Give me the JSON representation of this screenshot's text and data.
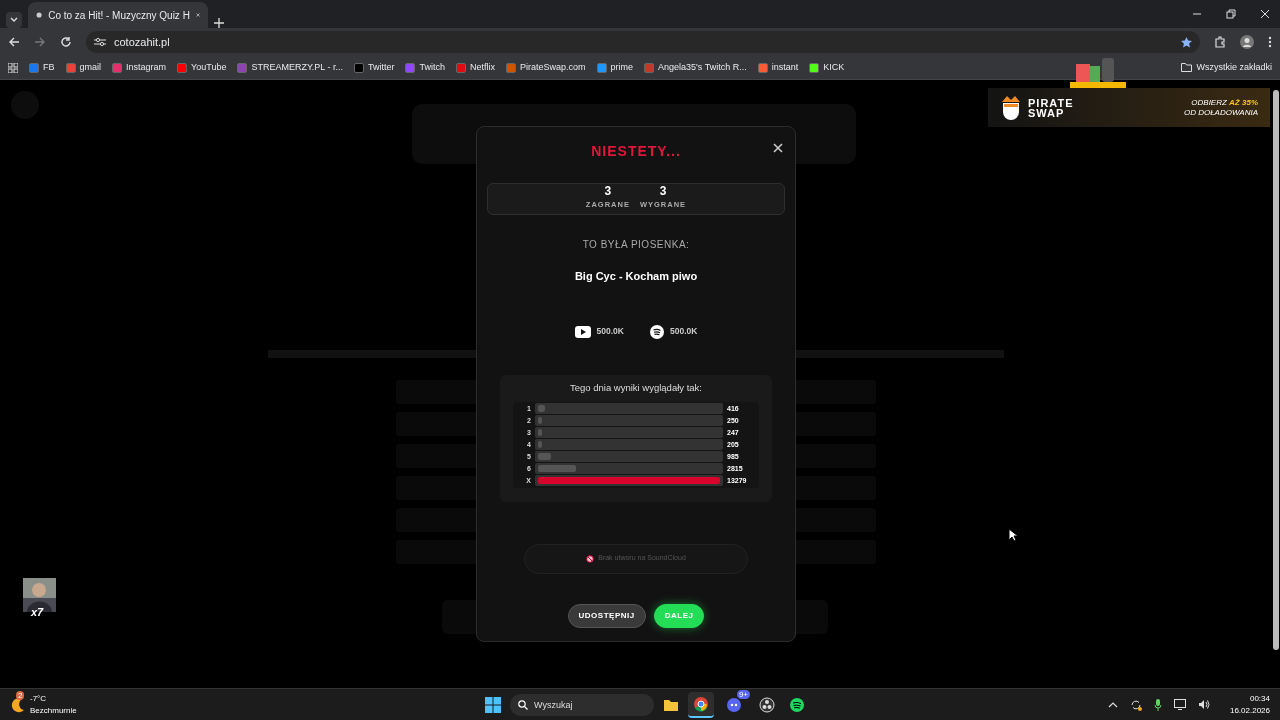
{
  "browser": {
    "tabs": [
      {
        "title": "Co to za Hit! - Muzyczny Quiz H",
        "selected": true
      }
    ],
    "address": "cotozahit.pl",
    "bookmarks": [
      {
        "label": "FB",
        "color": "#1877f2"
      },
      {
        "label": "gmail",
        "color": "#ea4335"
      },
      {
        "label": "Instagram",
        "color": "#e1306c"
      },
      {
        "label": "YouTube",
        "color": "#ff0000"
      },
      {
        "label": "STREAMERZY.PL - r...",
        "color": "#8e44ad"
      },
      {
        "label": "Twitter",
        "color": "#000000"
      },
      {
        "label": "Twitch",
        "color": "#9146ff"
      },
      {
        "label": "Netflix",
        "color": "#e50914"
      },
      {
        "label": "PirateSwap.com",
        "color": "#d35400"
      },
      {
        "label": "prime",
        "color": "#1a98ff"
      },
      {
        "label": "Angela35's Twitch R...",
        "color": "#c0392b"
      },
      {
        "label": "instant",
        "color": "#ff5a36"
      },
      {
        "label": "KICK",
        "color": "#53fc18"
      }
    ],
    "all_bookmarks": "Wszystkie zakładki"
  },
  "ad": {
    "brand_top": "PIRATE",
    "brand_bottom": "SWAP",
    "offer": "ODBIERZ **AŻ 35%**",
    "offer_line2": "OD DOŁADOWANIA"
  },
  "overlay": {
    "counter": "x7"
  },
  "modal": {
    "title": "NIESTETY...",
    "stats": [
      {
        "value": "3",
        "label": "ZAGRANE"
      },
      {
        "value": "3",
        "label": "WYGRANE"
      }
    ],
    "song_label": "TO BYŁA PIOSENKA:",
    "song": "Big Cyc - Kocham piwo",
    "counts": [
      {
        "kind": "youtube",
        "value": "500.0K"
      },
      {
        "kind": "spotify",
        "value": "500.0K"
      }
    ],
    "results": {
      "title": "Tego dnia wyniki wyglądały tak:",
      "rows": [
        {
          "label": "1",
          "value": "416",
          "level": 0.04,
          "highlight": false
        },
        {
          "label": "2",
          "value": "250",
          "level": 0.02,
          "highlight": false
        },
        {
          "label": "3",
          "value": "247",
          "level": 0.02,
          "highlight": false
        },
        {
          "label": "4",
          "value": "205",
          "level": 0.02,
          "highlight": false
        },
        {
          "label": "5",
          "value": "985",
          "level": 0.074,
          "highlight": false
        },
        {
          "label": "6",
          "value": "2815",
          "level": 0.21,
          "highlight": false
        },
        {
          "label": "X",
          "value": "13279",
          "level": 1,
          "highlight": true
        }
      ]
    },
    "soundcloud": "Brak utworu na SoundCloud",
    "buttons": [
      {
        "label": "UDOSTĘPNIJ",
        "kind": "secondary"
      },
      {
        "label": "DALEJ",
        "kind": "primary"
      }
    ]
  },
  "taskbar": {
    "weather_badge": "2",
    "temperature": "-7°C",
    "weather": "Bezchmurnie",
    "search_placeholder": "Wyszukaj",
    "apps": [
      {
        "kind": "folder",
        "selected": false
      },
      {
        "kind": "chrome",
        "selected": true
      },
      {
        "kind": "discord",
        "selected": false,
        "badge": "9+"
      },
      {
        "kind": "obs",
        "selected": false
      },
      {
        "kind": "spotify",
        "selected": false
      }
    ],
    "time": "00:34",
    "date": "16.02.2026"
  }
}
